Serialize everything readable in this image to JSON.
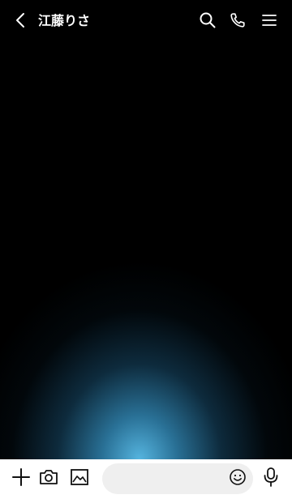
{
  "header": {
    "title": "江藤りさ",
    "icons": {
      "back": "chevron-left-icon",
      "search": "search-icon",
      "call": "phone-icon",
      "menu": "hamburger-menu-icon"
    }
  },
  "composer": {
    "placeholder": "",
    "value": "",
    "icons": {
      "add": "plus-icon",
      "camera": "camera-icon",
      "image": "image-icon",
      "emoji": "smiley-icon",
      "mic": "microphone-icon"
    }
  },
  "theme": {
    "background": "#000000",
    "glow": "#5abee6",
    "bar_background": "#ffffff",
    "input_background": "#efefef"
  }
}
